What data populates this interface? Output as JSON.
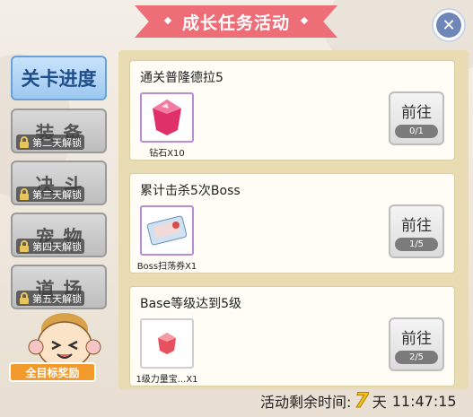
{
  "title": "成长任务活动",
  "close_icon": "close-icon",
  "tabs": [
    {
      "label": "关卡进度",
      "active": true,
      "lock": ""
    },
    {
      "label": "装备",
      "active": false,
      "lock": "第二天解锁"
    },
    {
      "label": "决斗",
      "active": false,
      "lock": "第三天解锁"
    },
    {
      "label": "宠物",
      "active": false,
      "lock": "第四天解锁"
    },
    {
      "label": "道场",
      "active": false,
      "lock": "第五天解锁"
    }
  ],
  "reward_label": "全目标奖励",
  "tasks": [
    {
      "title": "通关普隆德拉5",
      "item": "钻石X10",
      "button": "前往",
      "progress": "0/1"
    },
    {
      "title": "累计击杀5次Boss",
      "item": "Boss扫荡券X1",
      "button": "前往",
      "progress": "1/5"
    },
    {
      "title": "Base等级达到5级",
      "item": "1级力量宝...X1",
      "button": "前往",
      "progress": "2/5"
    }
  ],
  "timer": {
    "label": "活动剩余时间:",
    "days": "7",
    "days_unit": "天",
    "clock": "11:47:15"
  },
  "colors": {
    "banner": "#ee6e78",
    "active_tab": "#9ec8f0",
    "panel": "#e9dcb2",
    "timer_digit": "#f3c01a",
    "reward": "#f29a2c"
  }
}
